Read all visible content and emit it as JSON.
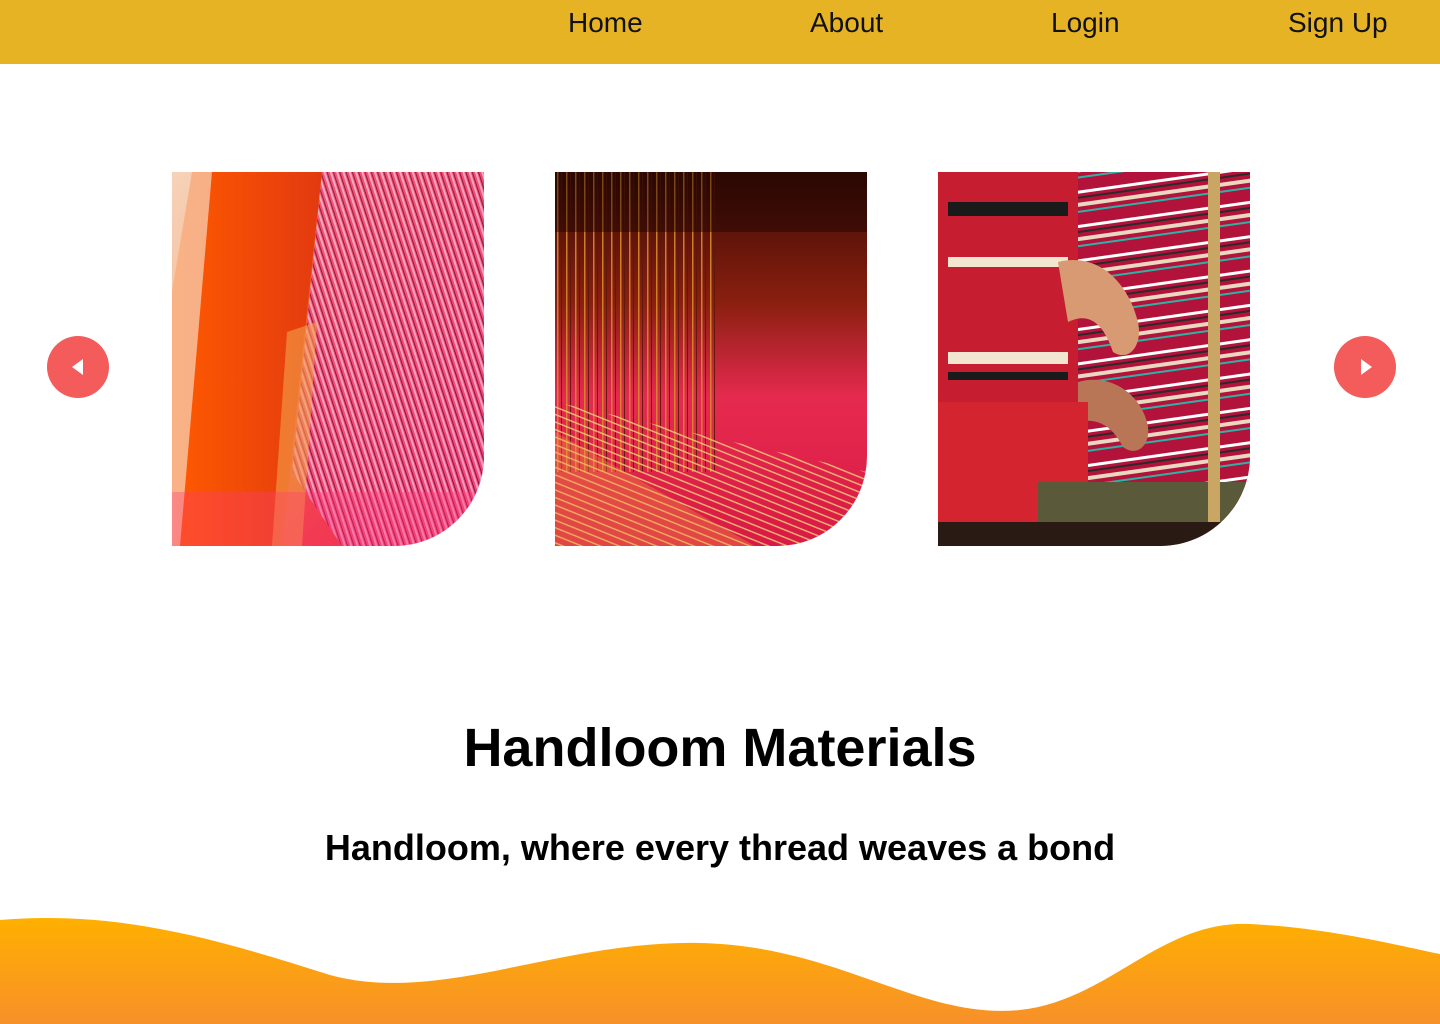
{
  "nav": {
    "home": "Home",
    "about": "About",
    "login": "Login",
    "signup": "Sign Up"
  },
  "carousel": {
    "slides": [
      {
        "alt": "Loom with pink and orange threads"
      },
      {
        "alt": "Close-up of red warp threads on a loom"
      },
      {
        "alt": "Hands weaving a striped red textile"
      }
    ],
    "prev_icon": "triangle-left-icon",
    "next_icon": "triangle-right-icon"
  },
  "hero": {
    "title": "Handloom Materials",
    "subtitle": "Handloom, where every thread weaves a bond"
  },
  "colors": {
    "navbar": "#e6b325",
    "arrow": "#f45b5b",
    "wave_top": "#ffb000",
    "wave_bottom": "#f7902a"
  }
}
